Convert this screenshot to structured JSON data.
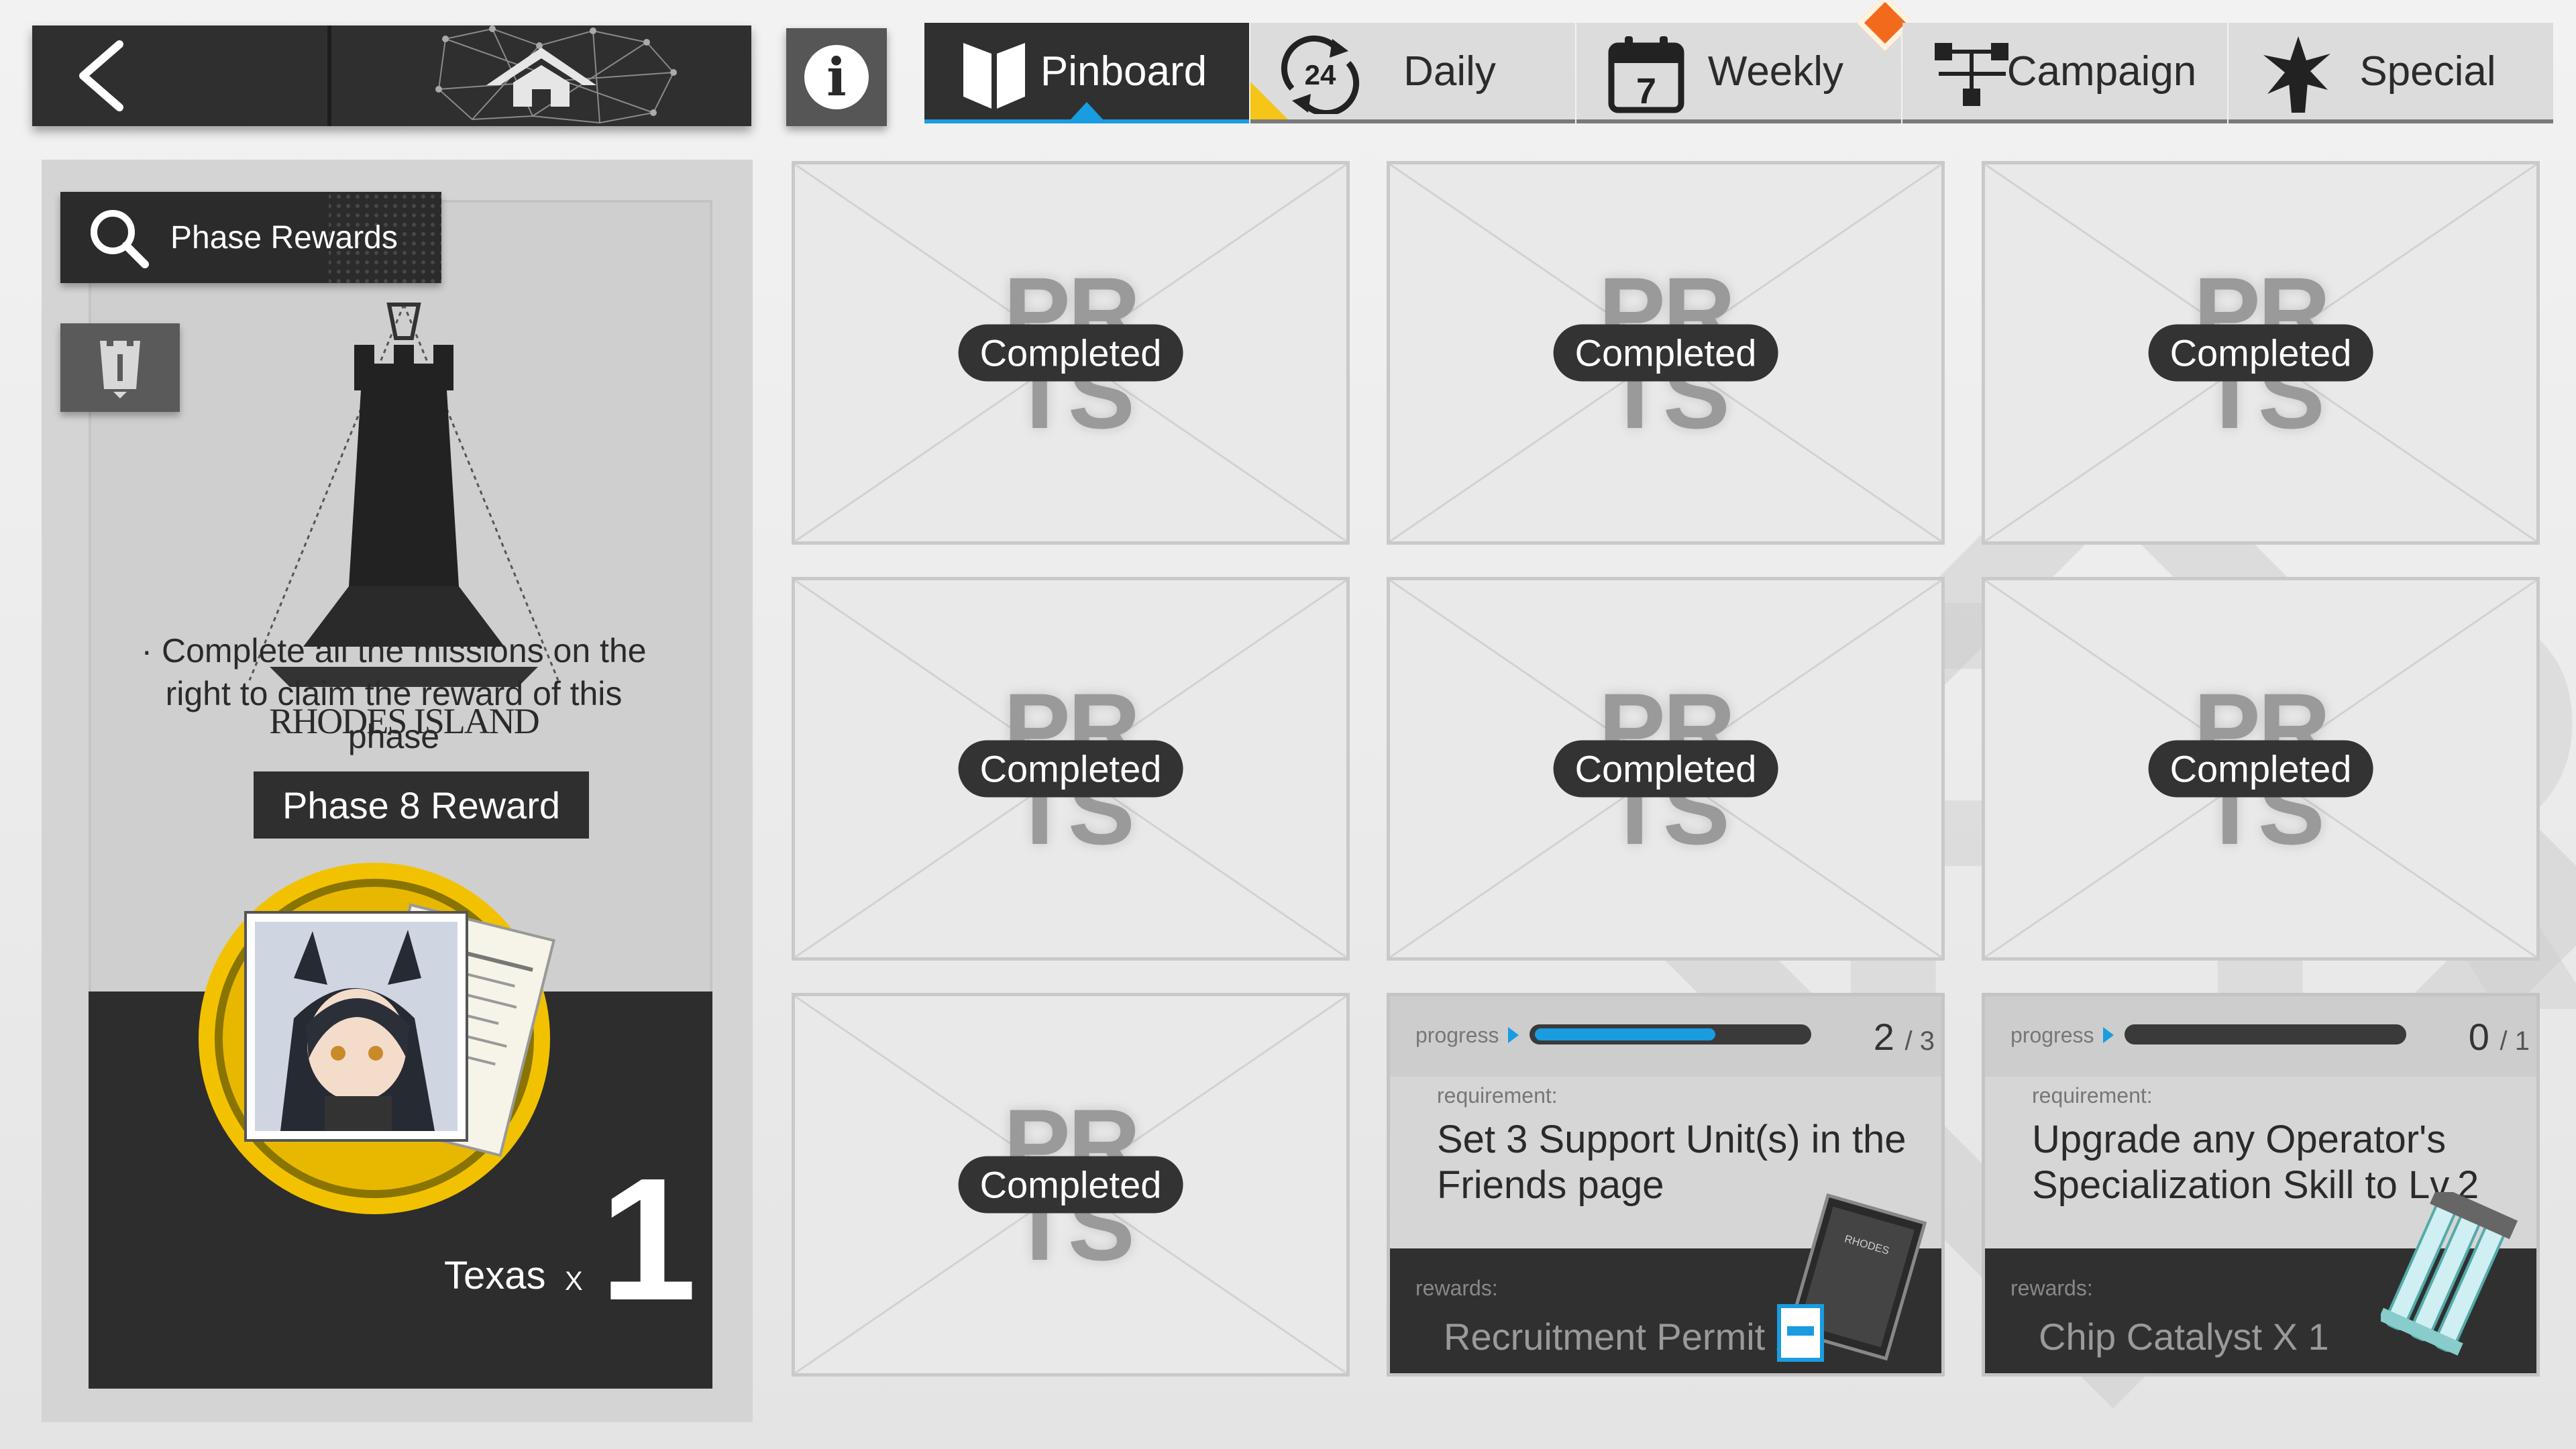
{
  "nav": {
    "back_icon": "chevron-left-icon",
    "home_icon": "home-icon",
    "info_icon": "info-icon",
    "info_glyph": "i"
  },
  "tabs": [
    {
      "label": "Pinboard",
      "icon": "pinboard-icon",
      "active": true
    },
    {
      "label": "Daily",
      "icon": "daily-24-icon",
      "active": false
    },
    {
      "label": "Weekly",
      "icon": "calendar-7-icon",
      "active": false
    },
    {
      "label": "Campaign",
      "icon": "campaign-icon",
      "active": false
    },
    {
      "label": "Special",
      "icon": "special-icon",
      "active": false
    }
  ],
  "left": {
    "phase_button": "Phase Rewards",
    "logo_text": "RHODES ISLAND",
    "description": "· Complete all the missions on the right to claim the reward of this phase",
    "phase_label": "Phase 8 Reward",
    "reward": {
      "name": "Texas",
      "x": "X",
      "count": "1"
    }
  },
  "missions": {
    "completed_label": "Completed",
    "completed_cards": 7,
    "active": [
      {
        "progress_label": "progress",
        "current": "2",
        "total": "/ 3",
        "progress_fraction": 0.667,
        "requirement_label": "requirement:",
        "requirement": "Set 3 Support Unit(s) in the Friends page",
        "rewards_label": "rewards:",
        "reward": "Recruitment Permit X",
        "reward_icon": "recruitment-permit-icon"
      },
      {
        "progress_label": "progress",
        "current": "0",
        "total": "/ 1",
        "progress_fraction": 0,
        "requirement_label": "requirement:",
        "requirement": "Upgrade any Operator's Specialization Skill to Lv.2",
        "rewards_label": "rewards:",
        "reward": "Chip Catalyst X 1",
        "reward_icon": "chip-catalyst-icon"
      }
    ]
  },
  "colors": {
    "accent": "#1a9ce0",
    "dark": "#2f2f2f",
    "alert": "#f26b1d",
    "medal_gold": "#f2c200"
  }
}
